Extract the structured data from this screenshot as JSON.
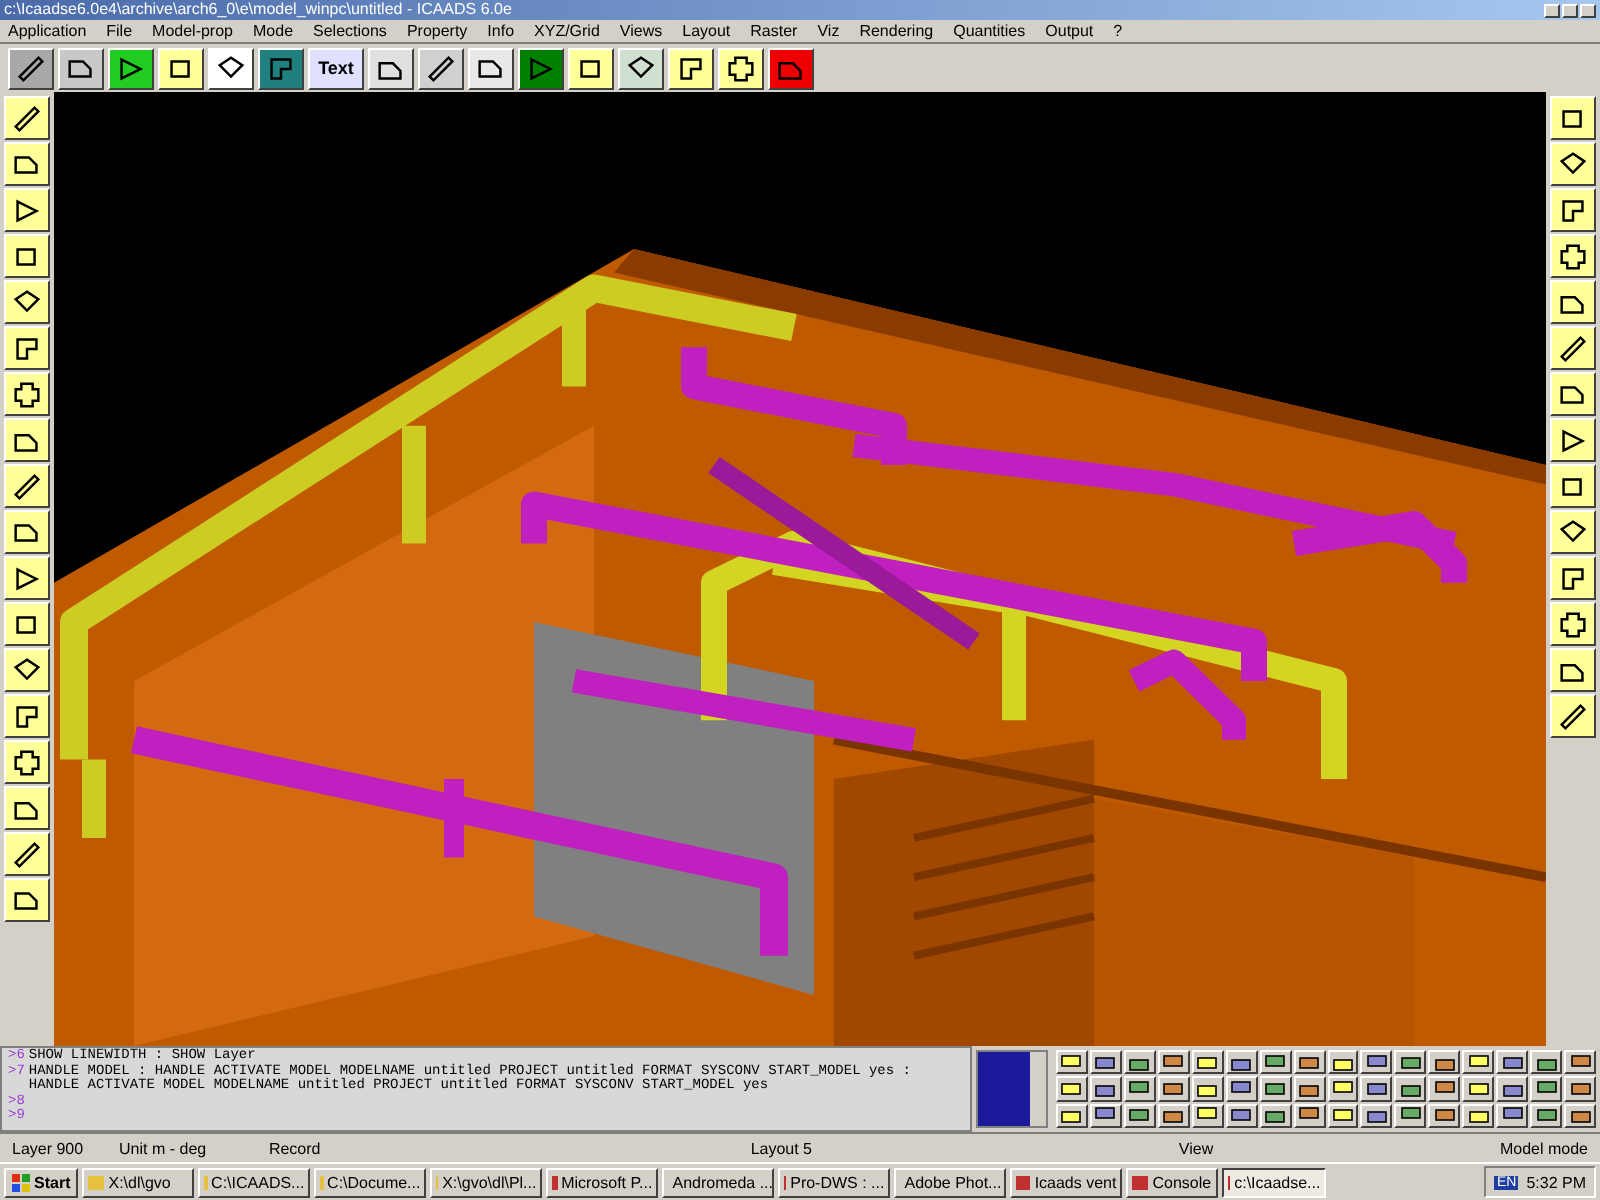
{
  "window": {
    "title": "c:\\Icaadse6.0e4\\archive\\arch6_0\\e\\model_winpc\\untitled - ICAADS 6.0e"
  },
  "menu": [
    "Application",
    "File",
    "Model-prop",
    "Mode",
    "Selections",
    "Property",
    "Info",
    "XYZ/Grid",
    "Views",
    "Layout",
    "Raster",
    "Viz",
    "Rendering",
    "Quantities",
    "Output",
    "?"
  ],
  "toolbar": {
    "text_button": "Text"
  },
  "command_lines": [
    {
      "prompt": ">6",
      "text": "SHOW LINEWIDTH  :  SHOW Layer"
    },
    {
      "prompt": ">7",
      "text": "HANDLE MODEL  :  HANDLE ACTIVATE MODEL MODELNAME untitled PROJECT untitled FORMAT SYSCONV START_MODEL yes   :  HANDLE ACTIVATE MODEL MODELNAME untitled PROJECT untitled FORMAT SYSCONV START_MODEL yes"
    },
    {
      "prompt": ">8"
    },
    {
      "prompt": ">9"
    }
  ],
  "status_bar": [
    "Layer 900",
    "Unit m - deg",
    "Record",
    "Layout  5",
    "View",
    "Model mode"
  ],
  "taskbar": {
    "start": "Start",
    "tasks": [
      {
        "label": "X:\\dl\\gvo",
        "selected": false
      },
      {
        "label": "C:\\ICAADS...",
        "selected": false
      },
      {
        "label": "C:\\Docume...",
        "selected": false
      },
      {
        "label": "X:\\gvo\\dl\\Pl...",
        "selected": false
      },
      {
        "label": "Microsoft P...",
        "selected": false
      },
      {
        "label": "Andromeda ...",
        "selected": false
      },
      {
        "label": "Pro-DWS : ...",
        "selected": false
      },
      {
        "label": "Adobe Phot...",
        "selected": false
      },
      {
        "label": "Icaads vent",
        "selected": false
      },
      {
        "label": "Console",
        "selected": false
      },
      {
        "label": "c:\\Icaadse...",
        "selected": true
      }
    ],
    "language": "EN",
    "time": "5:32 PM"
  }
}
